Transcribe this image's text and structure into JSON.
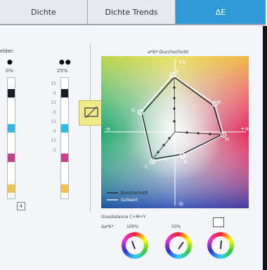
{
  "tabs": [
    {
      "label": "Dichte"
    },
    {
      "label": "Dichte Trends"
    },
    {
      "label": "ΔE"
    }
  ],
  "left_panel": {
    "section_label": "elder:",
    "col1_pct": "0%",
    "col2_pct": "25%",
    "ticks": [
      "15",
      "-5",
      "11",
      "-5",
      "11",
      "-5",
      "11",
      "-5"
    ],
    "button_label": "4"
  },
  "chart": {
    "title": "a*b*-Durchschnitt",
    "axis_labels": {
      "pos_b": "+b",
      "neg_b": "-b",
      "pos_a": "+a",
      "neg_a": "-a"
    },
    "point_labels": [
      "Y",
      "R",
      "M",
      "B",
      "C",
      "G"
    ],
    "legend": [
      {
        "label": "Durchschnitt"
      },
      {
        "label": "Sollwert"
      }
    ]
  },
  "gray_balance": {
    "title": "Graubalance C+M+Y",
    "ab_label": "Δa*b*",
    "dials": [
      {
        "pct": "100%"
      },
      {
        "pct": "50%"
      },
      {
        "pct": ""
      }
    ]
  },
  "colors": {
    "accent": "#2f9ad6",
    "tab_bg": "#e6eaef"
  }
}
